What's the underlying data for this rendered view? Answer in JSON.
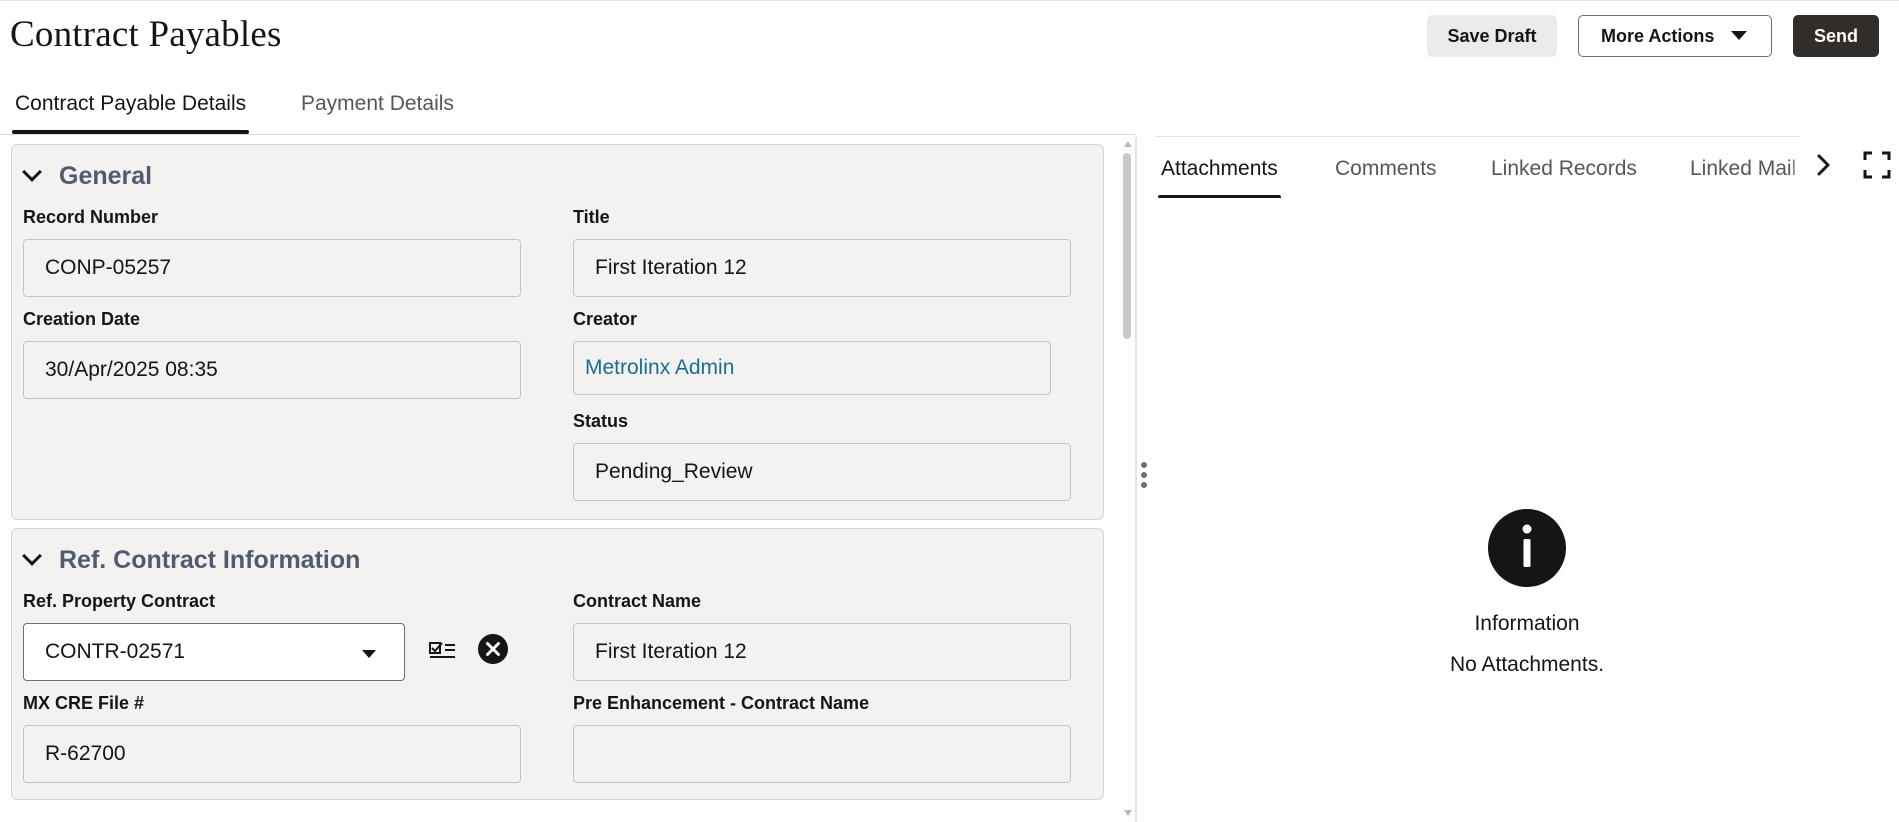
{
  "header": {
    "title": "Contract Payables",
    "save_draft": "Save Draft",
    "more_actions": "More Actions",
    "send": "Send"
  },
  "tabs": [
    {
      "label": "Contract Payable Details",
      "active": true
    },
    {
      "label": "Payment Details",
      "active": false
    }
  ],
  "general": {
    "title": "General",
    "record_number": {
      "label": "Record Number",
      "value": "CONP-05257"
    },
    "title_field": {
      "label": "Title",
      "value": "First Iteration 12"
    },
    "creation_date": {
      "label": "Creation Date",
      "value": "30/Apr/2025 08:35"
    },
    "creator": {
      "label": "Creator",
      "value": "Metrolinx Admin"
    },
    "status": {
      "label": "Status",
      "value": "Pending_Review"
    }
  },
  "ref_contract": {
    "title": "Ref. Contract Information",
    "property_contract": {
      "label": "Ref. Property Contract",
      "value": "CONTR-02571"
    },
    "contract_name": {
      "label": "Contract Name",
      "value": "First Iteration 12"
    },
    "mx_cre_file": {
      "label": "MX CRE File #",
      "value": "R-62700"
    },
    "pre_enh_name": {
      "label": "Pre Enhancement - Contract Name",
      "value": ""
    }
  },
  "right_panel": {
    "tabs": [
      {
        "label": "Attachments",
        "active": true
      },
      {
        "label": "Comments",
        "active": false
      },
      {
        "label": "Linked Records",
        "active": false
      },
      {
        "label": "Linked Mail",
        "active": false
      }
    ],
    "info_title": "Information",
    "info_message": "No Attachments."
  },
  "colors": {
    "accent_dark": "#312d2a",
    "link": "#1b6e92",
    "section_title": "#4f5b6e",
    "panel_bg": "#f3f2f1"
  },
  "icons": {
    "more_actions": "caret-down-icon",
    "section_toggle": "chevron-down-icon",
    "select_record": "checklist-icon",
    "clear": "clear-circle-icon",
    "tab_scroll": "chevron-right-icon",
    "expand": "fullscreen-icon",
    "info": "info-circle-icon"
  }
}
